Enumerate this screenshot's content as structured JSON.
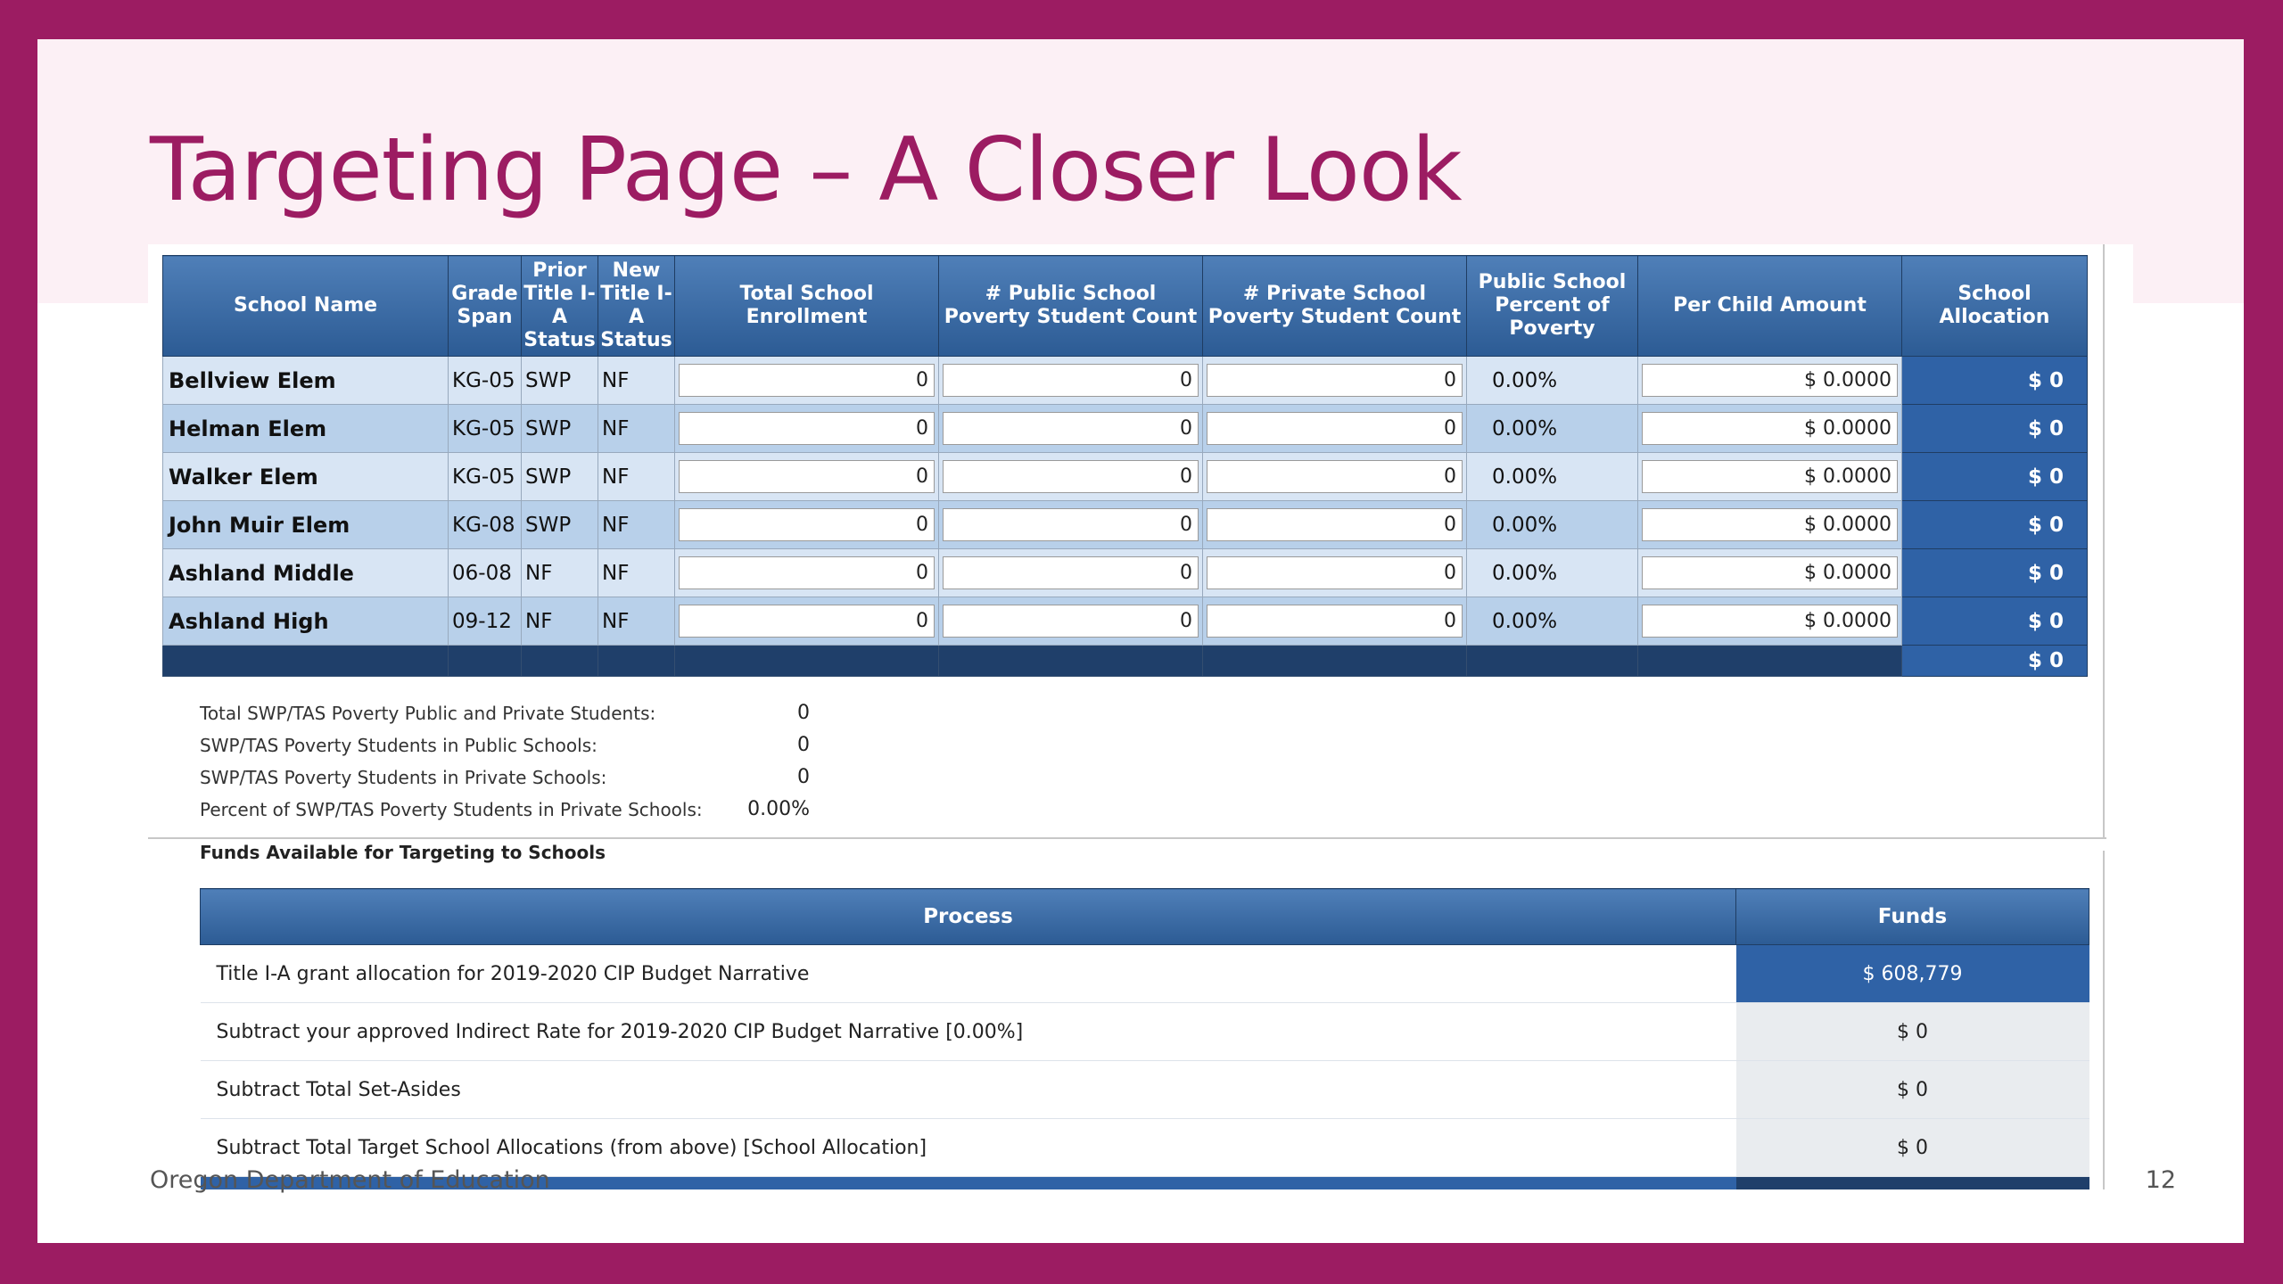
{
  "slide": {
    "title": "Targeting Page – A Closer Look",
    "footer_org": "Oregon Department of Education",
    "page_number": "12"
  },
  "targeting_table": {
    "headers": {
      "school_name": "School Name",
      "grade_span": "Grade Span",
      "prior_status": "Prior Title I-A Status",
      "new_status": "New Title I-A Status",
      "total_enrollment": "Total School Enrollment",
      "public_poverty": "# Public School Poverty Student Count",
      "private_poverty": "# Private School Poverty Student Count",
      "percent_poverty": "Public School Percent of Poverty",
      "per_child": "Per Child Amount",
      "allocation": "School Allocation"
    },
    "rows": [
      {
        "school": "Bellview Elem",
        "grade": "KG-05",
        "prior": "SWP",
        "new": "NF",
        "enrollment": "0",
        "public": "0",
        "private": "0",
        "percent": "0.00%",
        "per_child": "$ 0.0000",
        "allocation": "$ 0"
      },
      {
        "school": "Helman Elem",
        "grade": "KG-05",
        "prior": "SWP",
        "new": "NF",
        "enrollment": "0",
        "public": "0",
        "private": "0",
        "percent": "0.00%",
        "per_child": "$ 0.0000",
        "allocation": "$ 0"
      },
      {
        "school": "Walker Elem",
        "grade": "KG-05",
        "prior": "SWP",
        "new": "NF",
        "enrollment": "0",
        "public": "0",
        "private": "0",
        "percent": "0.00%",
        "per_child": "$ 0.0000",
        "allocation": "$ 0"
      },
      {
        "school": "John Muir Elem",
        "grade": "KG-08",
        "prior": "SWP",
        "new": "NF",
        "enrollment": "0",
        "public": "0",
        "private": "0",
        "percent": "0.00%",
        "per_child": "$ 0.0000",
        "allocation": "$ 0"
      },
      {
        "school": "Ashland Middle",
        "grade": "06-08",
        "prior": "NF",
        "new": "NF",
        "enrollment": "0",
        "public": "0",
        "private": "0",
        "percent": "0.00%",
        "per_child": "$ 0.0000",
        "allocation": "$ 0"
      },
      {
        "school": "Ashland High",
        "grade": "09-12",
        "prior": "NF",
        "new": "NF",
        "enrollment": "0",
        "public": "0",
        "private": "0",
        "percent": "0.00%",
        "per_child": "$ 0.0000",
        "allocation": "$ 0"
      }
    ],
    "total_allocation": "$ 0"
  },
  "summary": [
    {
      "label": "Total SWP/TAS Poverty Public and Private Students:",
      "value": "0"
    },
    {
      "label": "SWP/TAS Poverty Students in Public Schools:",
      "value": "0"
    },
    {
      "label": "SWP/TAS Poverty Students in Private Schools:",
      "value": "0"
    },
    {
      "label": "Percent of SWP/TAS Poverty Students in Private Schools:",
      "value": "0.00%"
    }
  ],
  "funds": {
    "legend": "Funds Available for Targeting to Schools",
    "process_header": "Process",
    "funds_header": "Funds",
    "rows": [
      {
        "process": "Title I-A grant allocation for 2019-2020 CIP Budget Narrative",
        "funds": "$ 608,779"
      },
      {
        "process": "Subtract your approved Indirect Rate for 2019-2020 CIP Budget Narrative [0.00%]",
        "funds": "$ 0"
      },
      {
        "process": "Subtract Total Set-Asides",
        "funds": "$ 0"
      },
      {
        "process": "Subtract Total Target School Allocations (from above) [School Allocation]",
        "funds": "$ 0"
      }
    ]
  },
  "colors": {
    "frame": "#9c1c62",
    "title": "#9c1c62",
    "header_blue": "#2c5b94",
    "allocation_blue": "#2f62a6"
  }
}
